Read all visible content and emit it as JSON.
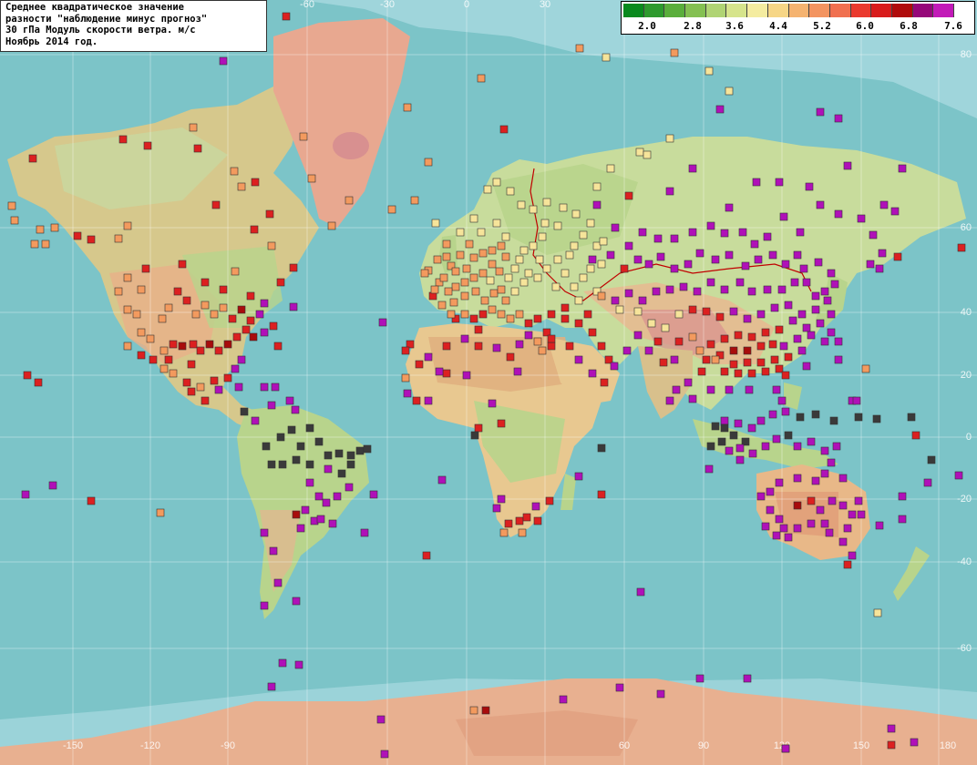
{
  "title": {
    "lines": [
      "Среднее квадратическое значение",
      "разности \"наблюдение минус прогноз\"",
      "30 гПа Модуль скорости ветра. м/с",
      "Ноябрь 2014 год."
    ]
  },
  "legend": {
    "colors": [
      "#0a8a1e",
      "#2e9a2e",
      "#5aae3c",
      "#84c052",
      "#b0d474",
      "#d6e48c",
      "#f4eca0",
      "#f6d686",
      "#f5b370",
      "#f39460",
      "#f07050",
      "#ea3a2e",
      "#d81c1c",
      "#b00c0c",
      "#96087a",
      "#c21ab8"
    ],
    "labels": [
      "2.0",
      "2.8",
      "3.6",
      "4.4",
      "5.2",
      "6.0",
      "6.8",
      "7.6"
    ]
  },
  "grid": {
    "lat_labels": [
      "80",
      "60",
      "40",
      "20",
      "0",
      "-20",
      "-40",
      "-60"
    ],
    "lon_labels": [
      "-150",
      "-120",
      "-90",
      "-60",
      "-30",
      "0",
      "30",
      "60",
      "90",
      "120",
      "150",
      "180"
    ]
  },
  "station_colors": {
    "yellow": "#f6e49a",
    "orange": "#f39a5e",
    "red_orange": "#ef5430",
    "red": "#dc2020",
    "dark_red": "#a80c0c",
    "magenta": "#b010b8",
    "dark_gray": "#3a3a3a"
  }
}
